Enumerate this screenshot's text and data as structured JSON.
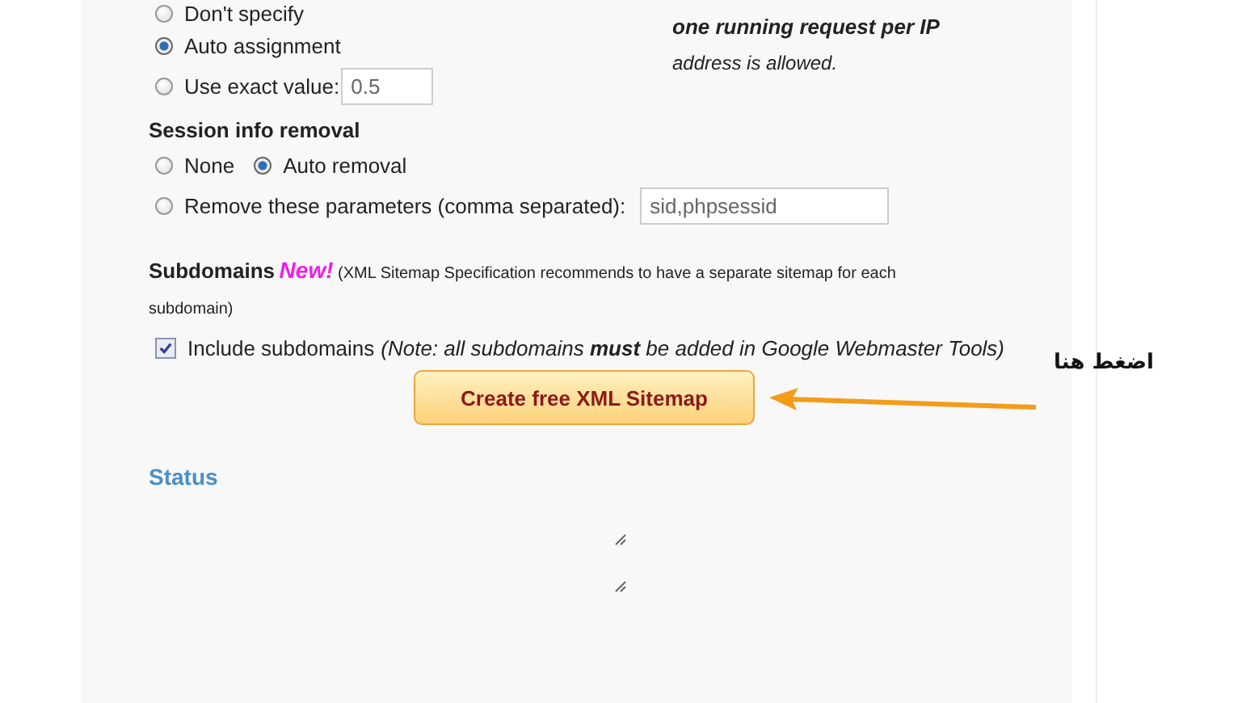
{
  "crawl_priority": {
    "options": [
      {
        "label": "Don't specify",
        "selected": false
      },
      {
        "label": "Auto assignment",
        "selected": true
      },
      {
        "label": "Use exact value:",
        "selected": false,
        "value": "0.5"
      }
    ]
  },
  "note": {
    "lines": [
      {
        "text": "one running request per IP",
        "bold": true
      },
      {
        "text": "address is allowed.",
        "bold": false
      }
    ]
  },
  "session_removal": {
    "title": "Session info removal",
    "rows": [
      [
        {
          "label": "None",
          "selected": false
        },
        {
          "label": "Auto removal",
          "selected": true
        }
      ],
      [
        {
          "label": "Remove these parameters (comma separated):",
          "selected": false,
          "value": "sid,phpsessid"
        }
      ]
    ]
  },
  "subdomains": {
    "title": "Subdomains",
    "badge": "New!",
    "description": "(XML Sitemap Specification recommends to have a separate sitemap for each subdomain)",
    "checkbox": {
      "label": "Include subdomains",
      "checked": true,
      "note": "(Note: all subdomains **must** be added in Google Webmaster Tools)"
    }
  },
  "create_button": {
    "label": "Create free XML Sitemap"
  },
  "status": {
    "title": "Status"
  },
  "annotation": {
    "text": "اضغط هنا"
  }
}
